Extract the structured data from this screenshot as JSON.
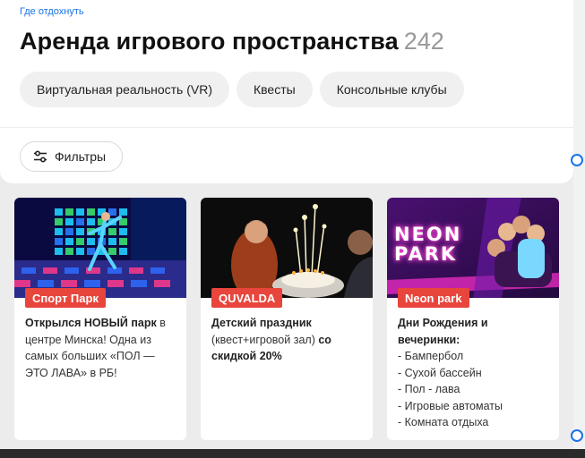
{
  "breadcrumb": "Где отдохнуть",
  "header": {
    "title": "Аренда игрового пространства",
    "count": "242"
  },
  "chips": [
    {
      "label": "Виртуальная реальность (VR)"
    },
    {
      "label": "Квесты"
    },
    {
      "label": "Консольные клубы"
    }
  ],
  "filters": {
    "label": "Фильтры"
  },
  "cards": [
    {
      "badge": "Спорт Парк",
      "desc_bold": "Открылся НОВЫЙ парк",
      "desc_rest": " в центре Минска! Одна из самых больших «ПОЛ — ЭТО ЛАВА» в РБ!"
    },
    {
      "badge": "QUVALDA",
      "desc_bold": "Детский праздник",
      "desc_mid": " (квест+игровой зал) ",
      "desc_bold2": "со скидкой 20%"
    },
    {
      "badge": "Neon park",
      "image_text": "NEON PARK",
      "desc_bold": "Дни Рождения и вечеринки:",
      "lines": [
        "- Бампербол",
        "- Сухой бассейн",
        "- Пол - лава",
        "- Игровые автоматы",
        "- Комната отдыха"
      ]
    }
  ],
  "colors": {
    "accent": "#1a73e8",
    "badge": "#e8453c"
  }
}
